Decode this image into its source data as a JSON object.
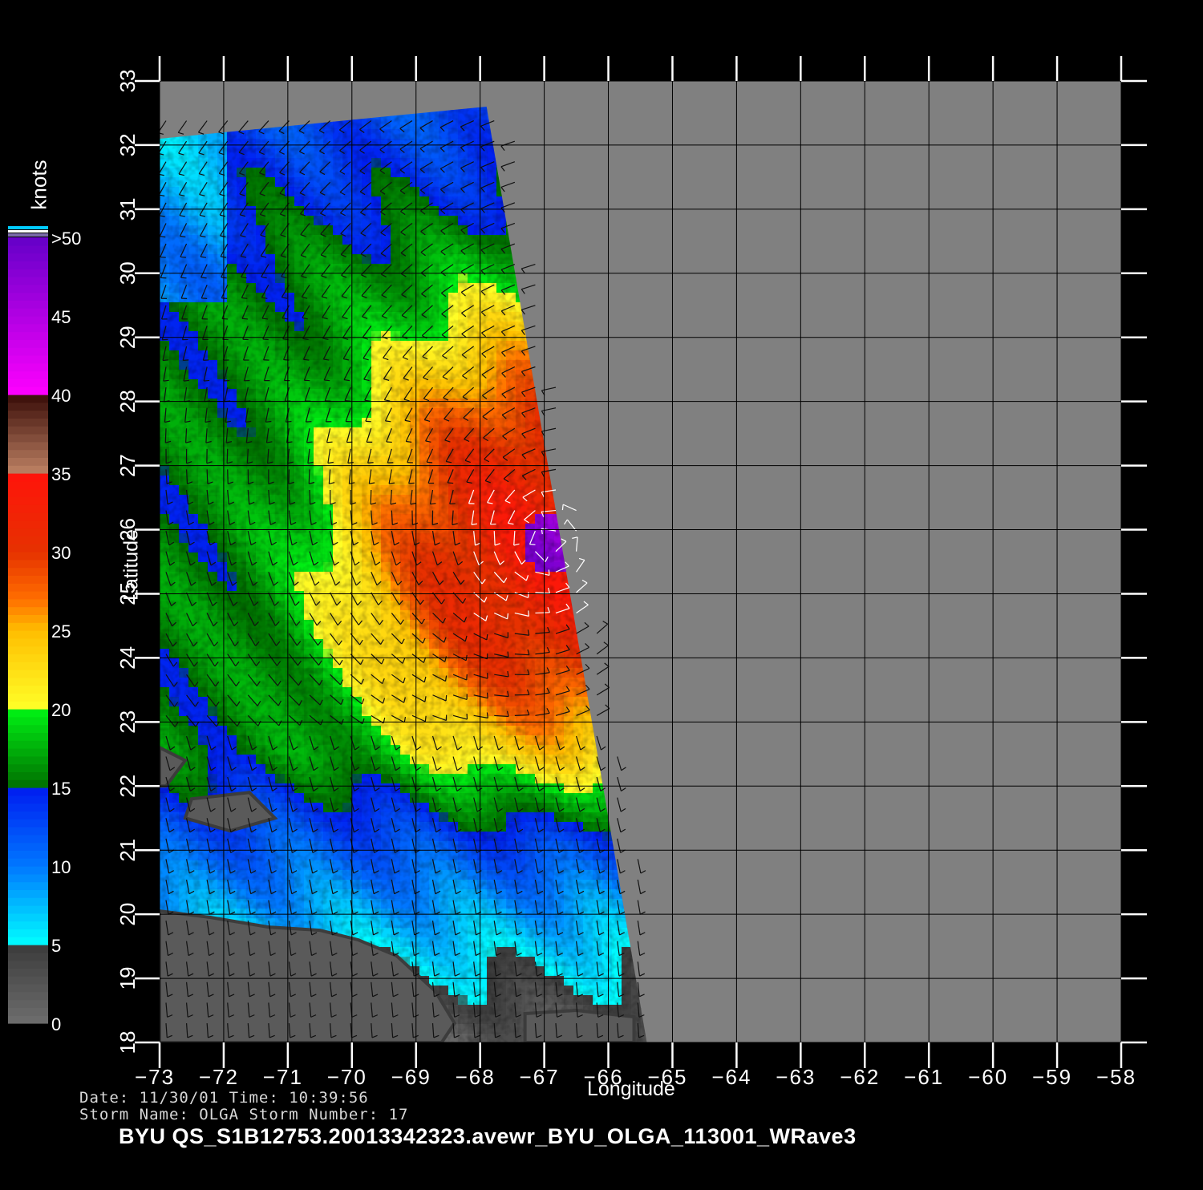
{
  "header": {
    "date_line": "Date: 11/30/01   Time: 10:39:56",
    "storm_line": "Storm Name: OLGA   Storm Number: 17",
    "title": "BYU QS_S1B12753.20013342323.avewr_BYU_OLGA_113001_WRave3"
  },
  "axes": {
    "xlabel": "Longitude",
    "ylabel": "Latitude",
    "x_ticks": [
      -73,
      -72,
      -71,
      -70,
      -69,
      -68,
      -67,
      -66,
      -65,
      -64,
      -63,
      -62,
      -61,
      -60,
      -59,
      -58
    ],
    "y_ticks": [
      18,
      19,
      20,
      21,
      22,
      23,
      24,
      25,
      26,
      27,
      28,
      29,
      30,
      31,
      32,
      33
    ],
    "xlim": [
      -73,
      -58
    ],
    "ylim": [
      18,
      33
    ]
  },
  "colorbar": {
    "unit": "knots",
    "labels": [
      {
        "value": 0,
        "text": "0"
      },
      {
        "value": 5,
        "text": "5"
      },
      {
        "value": 10,
        "text": "10"
      },
      {
        "value": 15,
        "text": "15"
      },
      {
        "value": 20,
        "text": "20"
      },
      {
        "value": 25,
        "text": "25"
      },
      {
        "value": 30,
        "text": "30"
      },
      {
        "value": 35,
        "text": "35"
      },
      {
        "value": 40,
        "text": "40"
      },
      {
        "value": 45,
        "text": "45"
      },
      {
        "value": 50,
        "text": ">50"
      }
    ]
  },
  "colors": {
    "background": "#000000",
    "no_data": "#808080",
    "land": "#5a5a5a",
    "grid": "#000000",
    "barb": "#111111",
    "barb_rain": "#ffffff"
  },
  "storm": {
    "name": "OLGA",
    "center_lon": -66.9,
    "center_lat": 25.8
  },
  "swath": {
    "corners_lon_lat": [
      [
        -73,
        32.1
      ],
      [
        -67.9,
        32.6
      ],
      [
        -65.4,
        18.0
      ],
      [
        -73,
        18.0
      ]
    ]
  }
}
